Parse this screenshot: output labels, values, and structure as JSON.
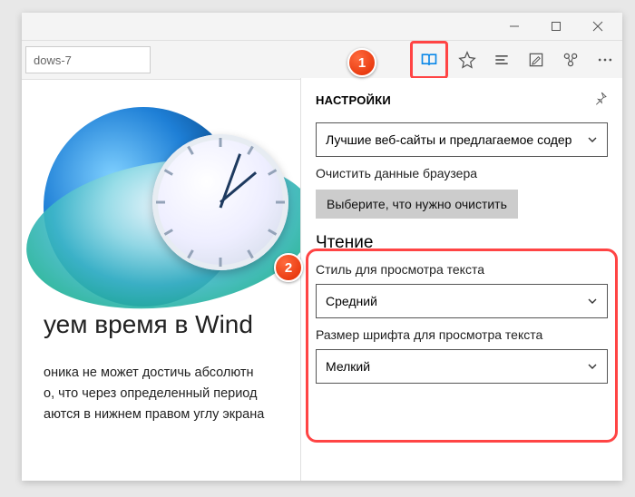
{
  "addressbar": {
    "text": "dows-7"
  },
  "page": {
    "heading_fragment": "уем время в Wind",
    "para_l1": "оника не может достичь абсолютн",
    "para_l2": "о, что через определенный период",
    "para_l3": "аются в нижнем правом углу экрана"
  },
  "panel": {
    "title": "НАСТРОЙКИ",
    "topics_select": "Лучшие веб-сайты и предлагаемое содер",
    "clear_label": "Очистить данные браузера",
    "clear_button": "Выберите, что нужно очистить",
    "reading_header": "Чтение",
    "style_label": "Стиль для просмотра текста",
    "style_value": "Средний",
    "fontsize_label": "Размер шрифта для просмотра текста",
    "fontsize_value": "Мелкий"
  },
  "markers": {
    "m1": "1",
    "m2": "2"
  }
}
